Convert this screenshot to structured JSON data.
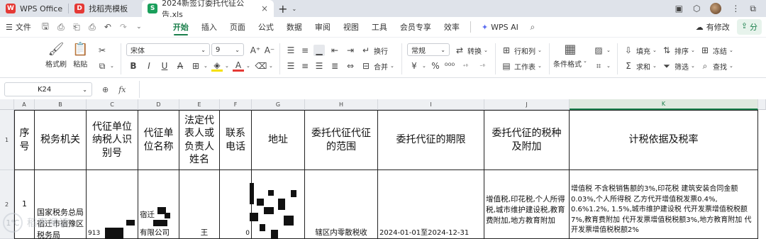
{
  "tabs": [
    {
      "label": "WPS Office",
      "icon": "wps-logo-icon",
      "color": "#e53935"
    },
    {
      "label": "找稻壳模板",
      "icon": "docer-icon",
      "color": "#e53935"
    },
    {
      "label": "2024新签订委托代征公告.xls",
      "icon": "spreadsheet-icon",
      "color": "#1a9f5b",
      "close": "×"
    }
  ],
  "new_tab": "+",
  "window_controls": {
    "restore": "⧉"
  },
  "menu": {
    "file": "文件",
    "items": [
      "开始",
      "插入",
      "页面",
      "公式",
      "数据",
      "审阅",
      "视图",
      "工具",
      "会员专享",
      "效率"
    ],
    "active": "开始",
    "wps_ai": "WPS AI",
    "has_changes": "有修改",
    "share": "分"
  },
  "ribbon": {
    "format_painter": "格式刷",
    "paste": "粘贴",
    "font_name": "宋体",
    "font_size": "9",
    "wrap": "换行",
    "merge": "合并",
    "number_format": "常规",
    "convert": "转换",
    "rows_cols": "行和列",
    "worksheet": "工作表",
    "cond_format": "条件格式",
    "fill": "填充",
    "sort": "排序",
    "freeze": "冻结",
    "sum": "求和",
    "filter": "筛选",
    "find": "查找",
    "yuan": "¥",
    "percent": "%",
    "bold": "B",
    "italic": "I",
    "underline": "U",
    "strike": "A"
  },
  "formula_bar": {
    "cell_ref": "K24",
    "fx": "fx",
    "value": ""
  },
  "columns": [
    "A",
    "B",
    "C",
    "D",
    "E",
    "F",
    "G",
    "H",
    "I",
    "J",
    "K"
  ],
  "selected_column": "K",
  "rows": [
    "1",
    "2"
  ],
  "header_row": [
    "序号",
    "税务机关",
    "代征单位纳税人识别号",
    "代征单位名称",
    "法定代表人或负责人姓名",
    "联系电话",
    "地址",
    "委托代征代征的范围",
    "委托代征的期限",
    "委托代征的税种及附加",
    "计税依据及税率"
  ],
  "data_row": {
    "seq": "1",
    "tax_office": "国家税务总局宿迁市宿豫区税务局",
    "taxpayer_id": "913",
    "unit_name_1": "宿迁",
    "unit_name_2": "有限公司",
    "legal_rep": "王",
    "phone": "0",
    "scope": "辖区内零散税收",
    "period": "2024-01-01至2024-12-31",
    "tax_types": "增值税,印花税,个人所得税,城市维护建设税,教育费附加,地方教育附加",
    "basis": "增值税 不含税销售额的3%,印花税 建筑安装合同金额0.03%,个人所得税 乙方代开增值税发票0.4%, 0.6%1.2%, 1.5%,城市维护建设税 代开发票增值税税额7%,教育费附加 代开发票增值税税额3%,地方教育附加 代开发票增值税税额2%"
  },
  "watermark": "稻壳阅读"
}
